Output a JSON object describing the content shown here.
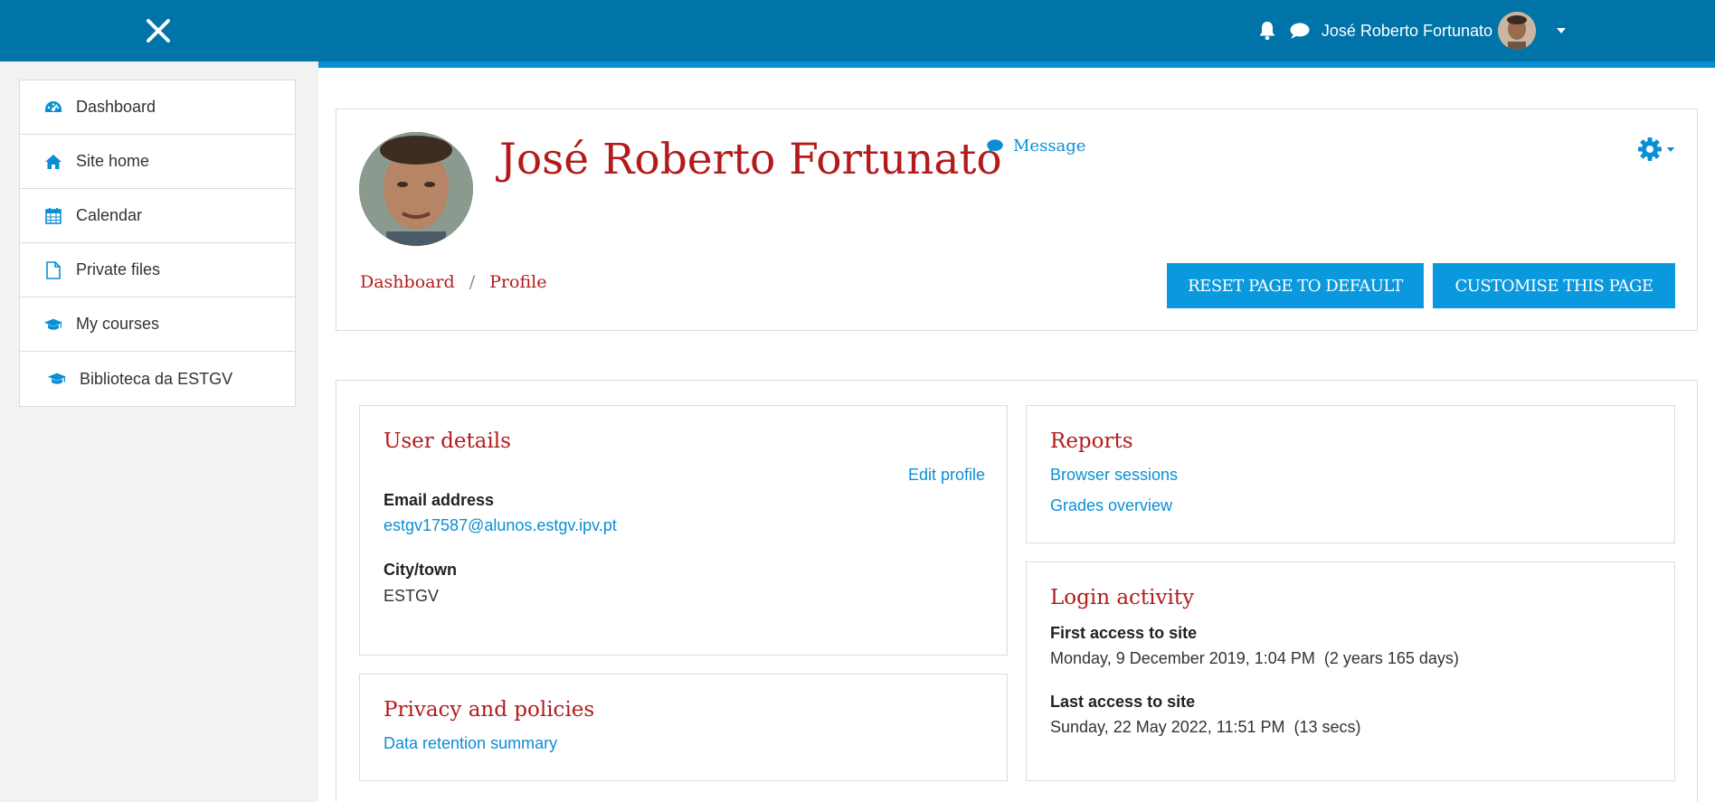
{
  "navbar": {
    "close_icon": "close-icon",
    "username": "José Roberto Fortunato",
    "notification_icon": "bell-icon",
    "messages_icon": "chat-icon",
    "menu_caret_icon": "caret-down-icon"
  },
  "sidebar": {
    "items": [
      {
        "label": "Dashboard",
        "icon": "dashboard-icon"
      },
      {
        "label": "Site home",
        "icon": "home-icon"
      },
      {
        "label": "Calendar",
        "icon": "calendar-icon"
      },
      {
        "label": "Private files",
        "icon": "file-icon"
      },
      {
        "label": "My courses",
        "icon": "graduation-cap-icon"
      },
      {
        "label": "Biblioteca da ESTGV",
        "icon": "graduation-cap-icon"
      }
    ]
  },
  "profile": {
    "name": "José Roberto Fortunato",
    "message_label": "Message",
    "breadcrumb": [
      "Dashboard",
      "Profile"
    ],
    "breadcrumb_separator": "/",
    "reset_button": "RESET PAGE TO DEFAULT",
    "customise_button": "CUSTOMISE THIS PAGE"
  },
  "user_details": {
    "title": "User details",
    "edit_profile": "Edit profile",
    "email_label": "Email address",
    "email_value": "estgv17587@alunos.estgv.ipv.pt",
    "city_label": "City/town",
    "city_value": "ESTGV"
  },
  "reports": {
    "title": "Reports",
    "links": [
      "Browser sessions",
      "Grades overview"
    ]
  },
  "privacy": {
    "title": "Privacy and policies",
    "link": "Data retention summary"
  },
  "login_activity": {
    "title": "Login activity",
    "first_label": "First access to site",
    "first_value": "Monday, 9 December 2019, 1:04 PM  (2 years 165 days)",
    "last_label": "Last access to site",
    "last_value": "Sunday, 22 May 2022, 11:51 PM  (13 secs)"
  },
  "colors": {
    "navbar": "#0073a8",
    "accent": "#0a99de",
    "heading": "#b31b1b",
    "link": "#0a8ed6"
  }
}
